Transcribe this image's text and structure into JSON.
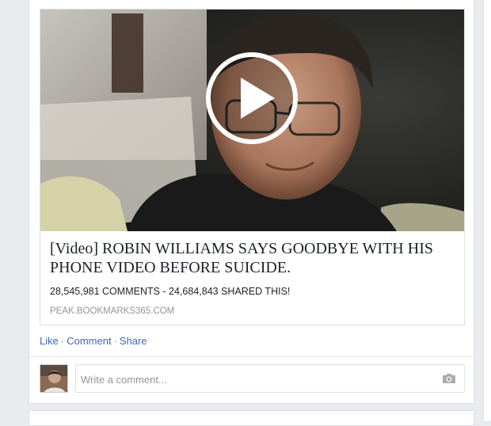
{
  "post": {
    "preview": {
      "title": "[Video] ROBIN WILLIAMS SAYS GOODBYE WITH HIS PHONE VIDEO BEFORE SUICIDE.",
      "description": "28,545,981 COMMENTS - 24,684,843 SHARED THIS!",
      "domain": "PEAK.BOOKMARKS365.COM"
    },
    "actions": {
      "like": "Like",
      "separator": "·",
      "comment": "Comment",
      "share": "Share"
    },
    "comment_input": {
      "placeholder": "Write a comment...",
      "value": ""
    }
  },
  "icons": {
    "play": "play-icon",
    "camera": "camera-icon"
  },
  "colors": {
    "link": "#4267b2",
    "background": "#e9ebee",
    "muted": "#90949c"
  }
}
